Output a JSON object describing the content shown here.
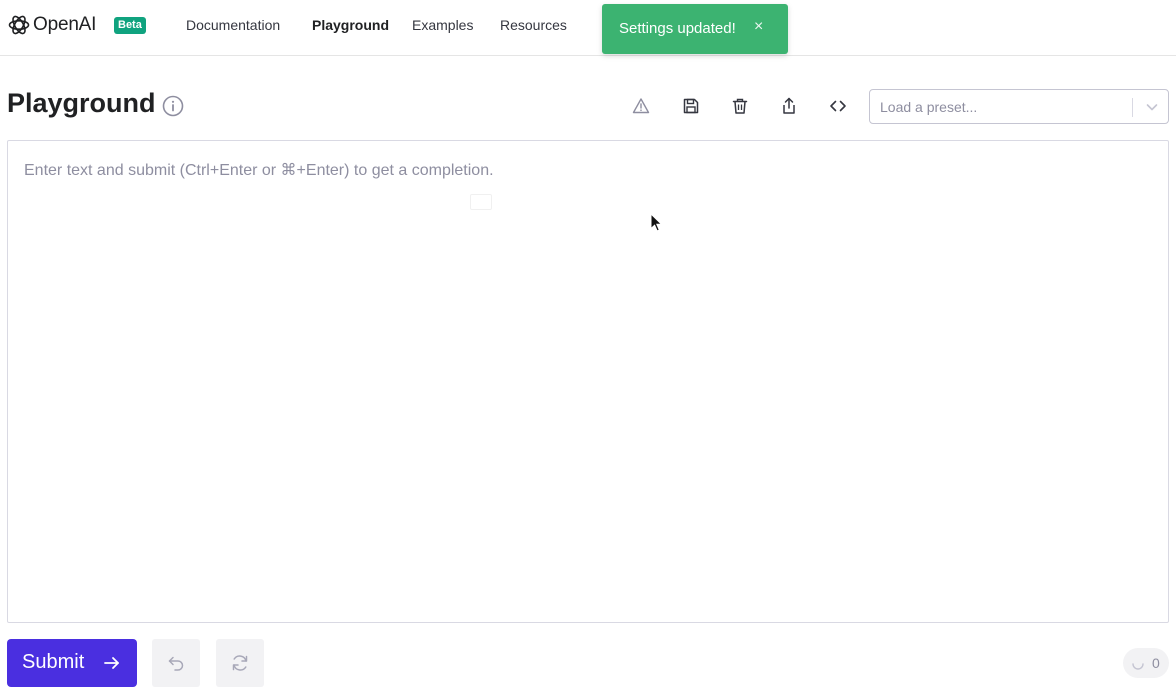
{
  "header": {
    "logo_text": "OpenAI",
    "badge": "Beta",
    "nav": [
      "Documentation",
      "Playground",
      "Examples",
      "Resources"
    ],
    "active_nav": "Playground"
  },
  "toast": {
    "message": "Settings updated!",
    "close_glyph": "×",
    "color": "#3cb371"
  },
  "page": {
    "title": "Playground"
  },
  "toolbar": {
    "icons": [
      "warning-icon",
      "save-icon",
      "trash-icon",
      "share-icon",
      "code-icon"
    ]
  },
  "preset": {
    "placeholder": "Load a preset..."
  },
  "editor": {
    "placeholder": "Enter text and submit (Ctrl+Enter or ⌘+Enter) to get a completion.",
    "value": ""
  },
  "footer": {
    "submit_label": "Submit",
    "token_count": "0"
  },
  "colors": {
    "accent": "#4a2fe0",
    "brand_green": "#10a37f"
  }
}
